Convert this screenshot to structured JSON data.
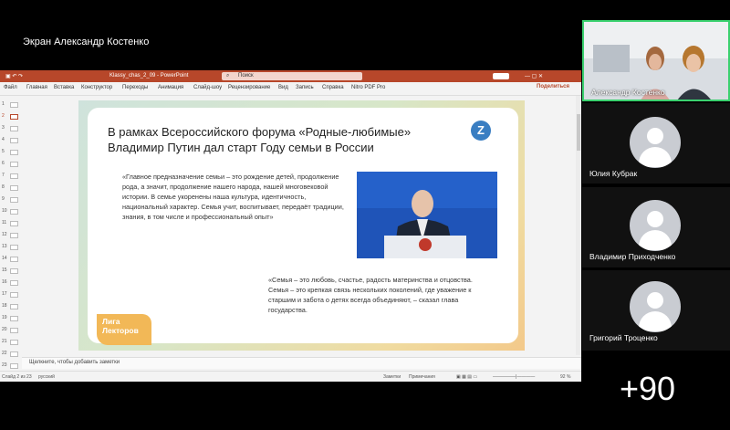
{
  "meeting": {
    "share_label": "Экран Александр Костенко",
    "more_count": "+90"
  },
  "participants": [
    {
      "name": "Александр Костенко",
      "video": true
    },
    {
      "name": "Юлия Кубрак",
      "video": false
    },
    {
      "name": "Владимир Приходченко",
      "video": false
    },
    {
      "name": "Григорий Троценко",
      "video": false
    }
  ],
  "powerpoint": {
    "file_title": "Klassy_chas_2_09  -  PowerPoint",
    "search_placeholder": "Поиск",
    "share_button": "Поделиться",
    "ribbon_tabs": [
      "Файл",
      "Главная",
      "Вставка",
      "Конструктор",
      "Переходы",
      "Анимация",
      "Слайд-шоу",
      "Рецензирование",
      "Вид",
      "Запись",
      "Справка",
      "Nitro PDF Pro"
    ],
    "slide_numbers": [
      "1",
      "2",
      "3",
      "4",
      "5",
      "6",
      "7",
      "8",
      "9",
      "10",
      "11",
      "12",
      "13",
      "14",
      "15",
      "16",
      "17",
      "18",
      "19",
      "20",
      "21",
      "22",
      "23"
    ],
    "notes_placeholder": "Щелкните, чтобы добавить заметки",
    "status_slide": "Слайд 2 из 23",
    "status_lang": "русский",
    "status_notes": "Заметки",
    "status_comments": "Примечания",
    "status_zoom": "92 %"
  },
  "slide": {
    "title": "В рамках Всероссийского форума «Родные-любимые» Владимир Путин дал старт Году семьи в России",
    "quote1": "«Главное предназначение семьи – это рождение детей, продолжение рода, а значит, продолжение нашего народа, нашей многовековой истории. В семье укоренены наша культура, идентичность, национальный характер. Семья учит, воспитывает, передаёт традиции, знания, в том числе и профессиональный опыт»",
    "quote2": "«Семья – это любовь, счастье, радость материнства и отцовства. Семья – это крепкая связь нескольких поколений, где уважение к старшим и забота о детях всегда объединяют, – сказал глава государства.",
    "badge": "Лига Лекторов",
    "logo_letter": "Z"
  }
}
